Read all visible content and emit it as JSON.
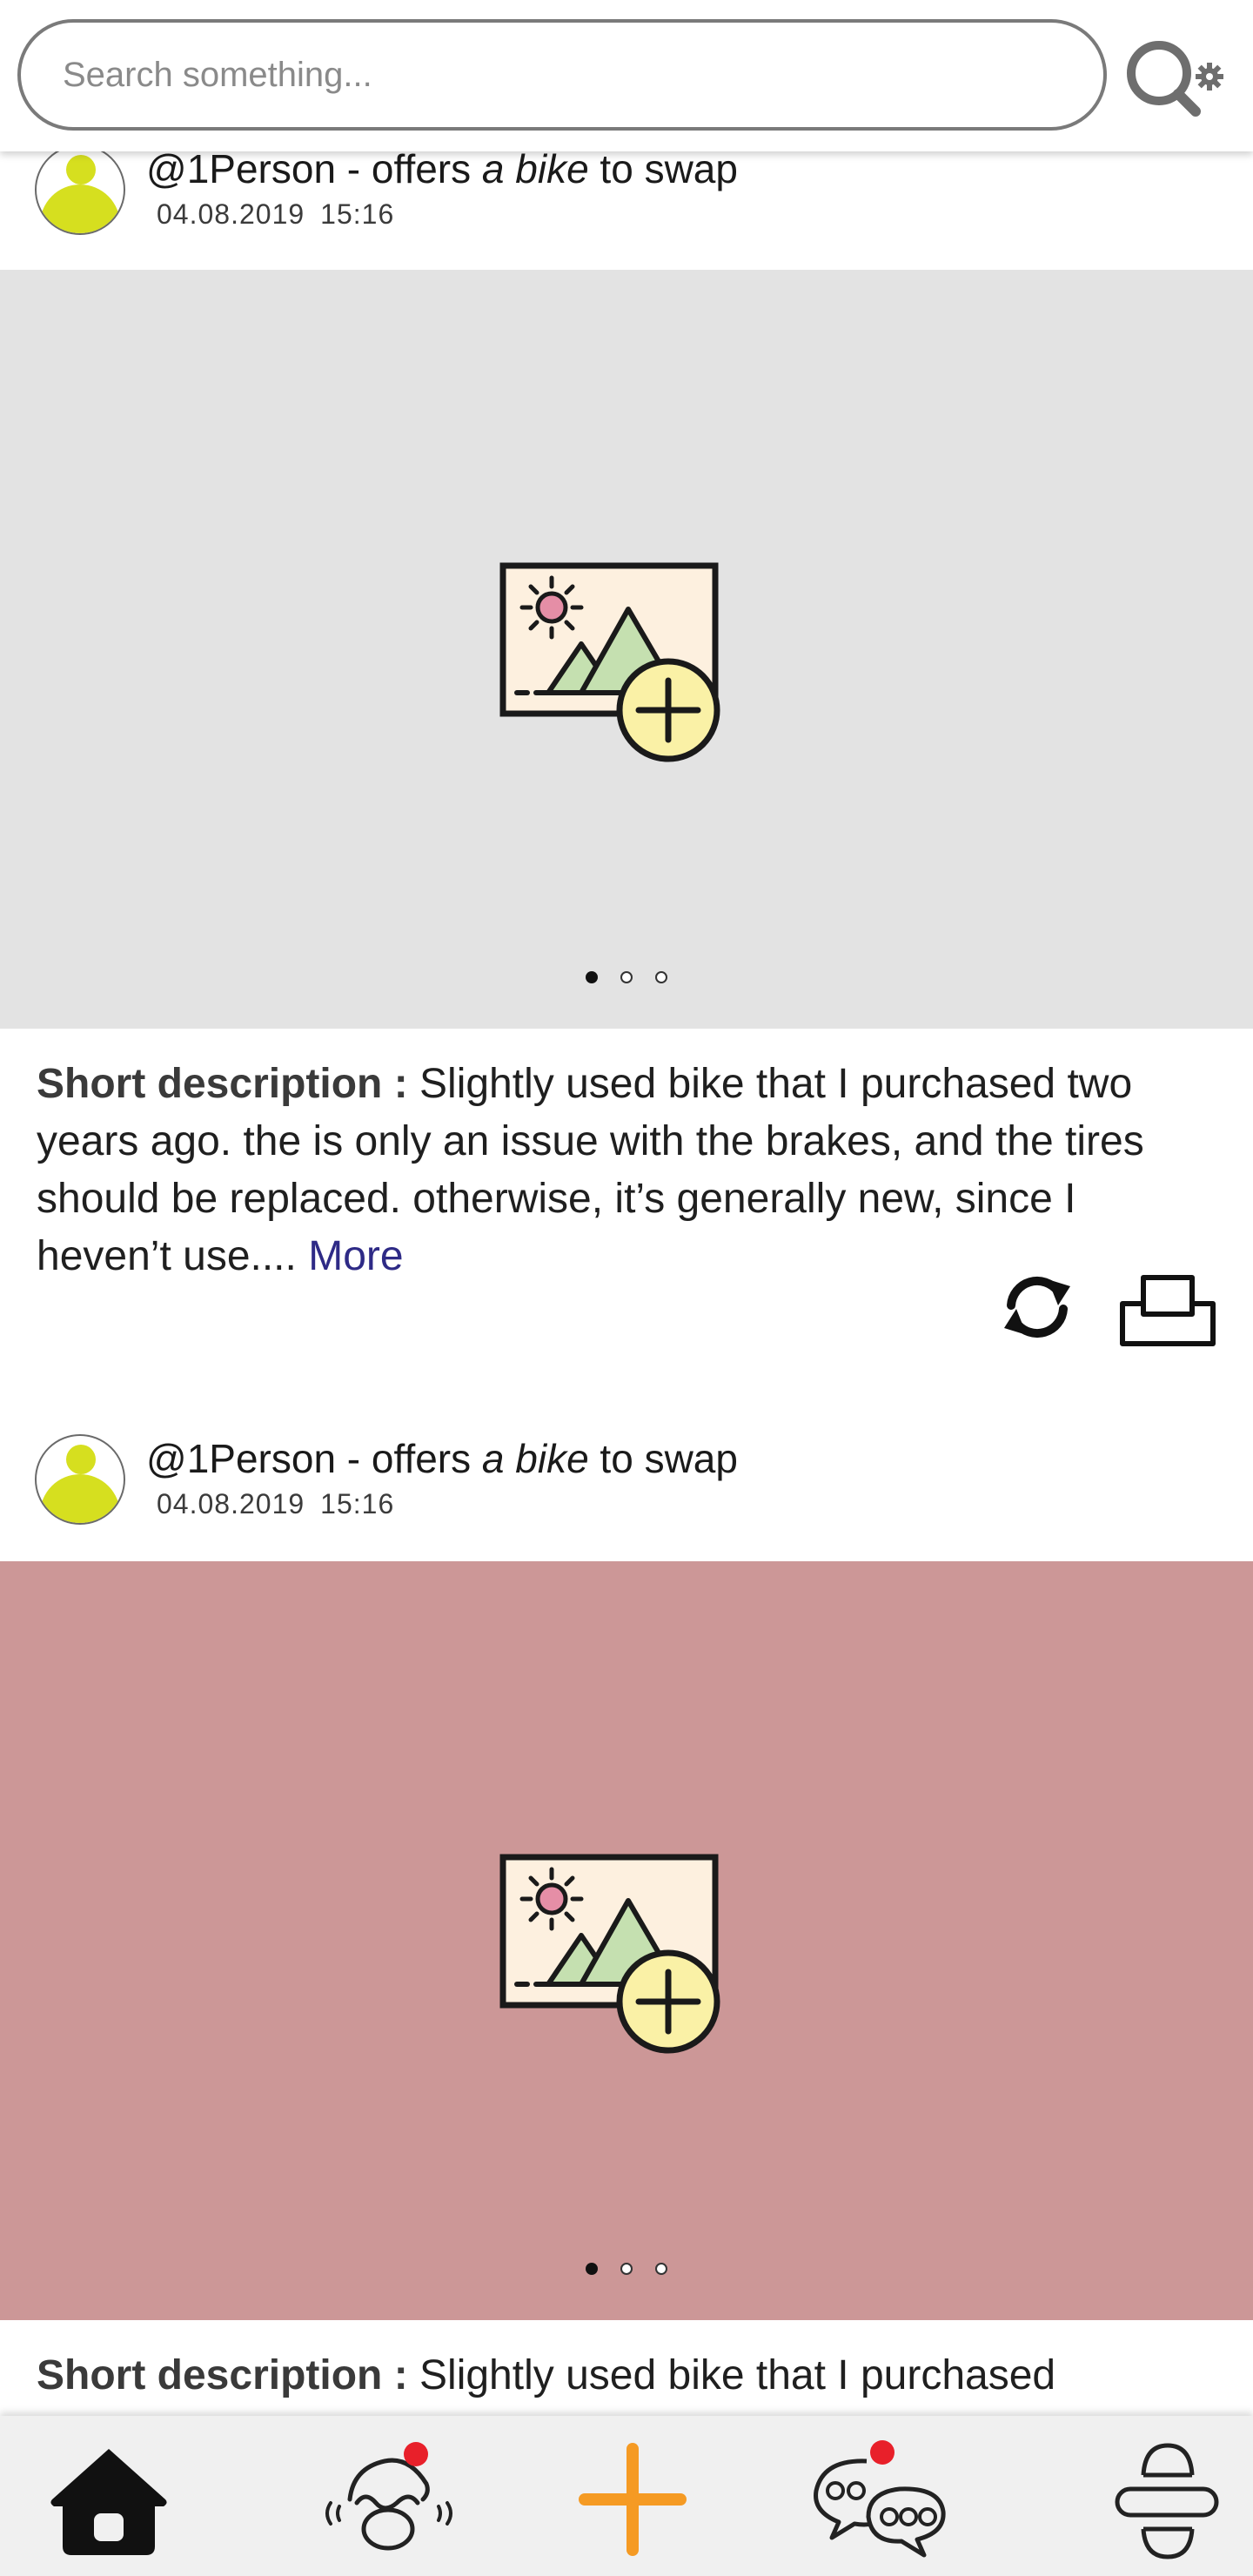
{
  "search": {
    "placeholder": "Search something..."
  },
  "posts": [
    {
      "user": "@1Person",
      "action_prefix": " - offers ",
      "item": "a bike",
      "action_suffix": " to swap",
      "date": "04.08.2019",
      "time": "15:16",
      "media_bg": "#e3e3e3",
      "carousel": {
        "count": 3,
        "active": 1
      },
      "description_label": "Short description : ",
      "description": "Slightly used bike that I purchased two years ago. the is only an issue with the brakes, and the tires should be replaced. otherwise, it’s generally new, since I heven’t use....",
      "more_label": "More"
    },
    {
      "user": "@1Person",
      "action_prefix": " - offers ",
      "item": "a bike",
      "action_suffix": " to swap",
      "date": "04.08.2019",
      "time": "15:16",
      "media_bg": "#cc9797",
      "carousel": {
        "count": 3,
        "active": 1
      },
      "description_label": "Short description : ",
      "description": "Slightly used bike that I purchased"
    }
  ],
  "nav": {
    "items": [
      {
        "icon": "home-icon"
      },
      {
        "icon": "swap-requests-icon",
        "notification": true
      },
      {
        "icon": "add-icon"
      },
      {
        "icon": "chat-icon",
        "notification": true
      },
      {
        "icon": "menu-icon"
      }
    ],
    "accent": "#f59a23",
    "notification_color": "#e8202a"
  }
}
